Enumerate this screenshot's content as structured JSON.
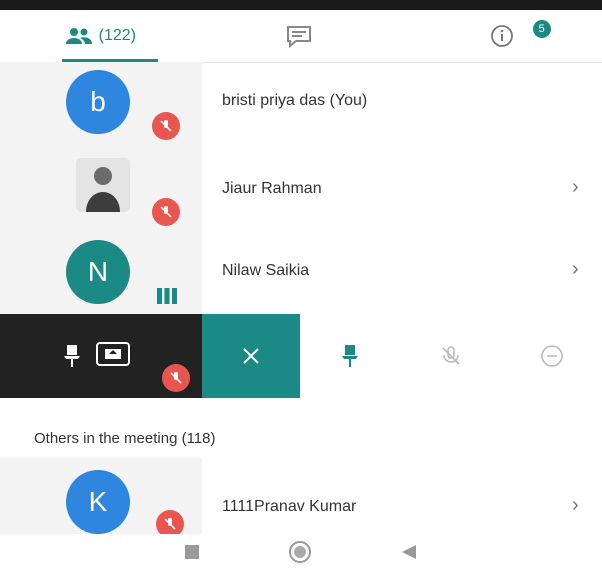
{
  "tabs": {
    "participants_count": "(122)",
    "chat_badge": "5"
  },
  "participants": [
    {
      "initial": "b",
      "name": "bristi priya das (You)",
      "avatar_color": "#2e86de"
    },
    {
      "initial": "",
      "name": "Jiaur Rahman",
      "avatar_color": "#cfcfcf"
    },
    {
      "initial": "N",
      "name": "Nilaw Saikia",
      "avatar_color": "#1b8a84"
    }
  ],
  "others": {
    "title": "Others in the meeting (118)",
    "items": [
      {
        "initial": "K",
        "name": "1111Pranav Kumar",
        "avatar_color": "#2e86de"
      }
    ]
  },
  "colors": {
    "accent": "#1b8a84",
    "mute": "#e8564f",
    "avatar_blue": "#2e86de"
  }
}
